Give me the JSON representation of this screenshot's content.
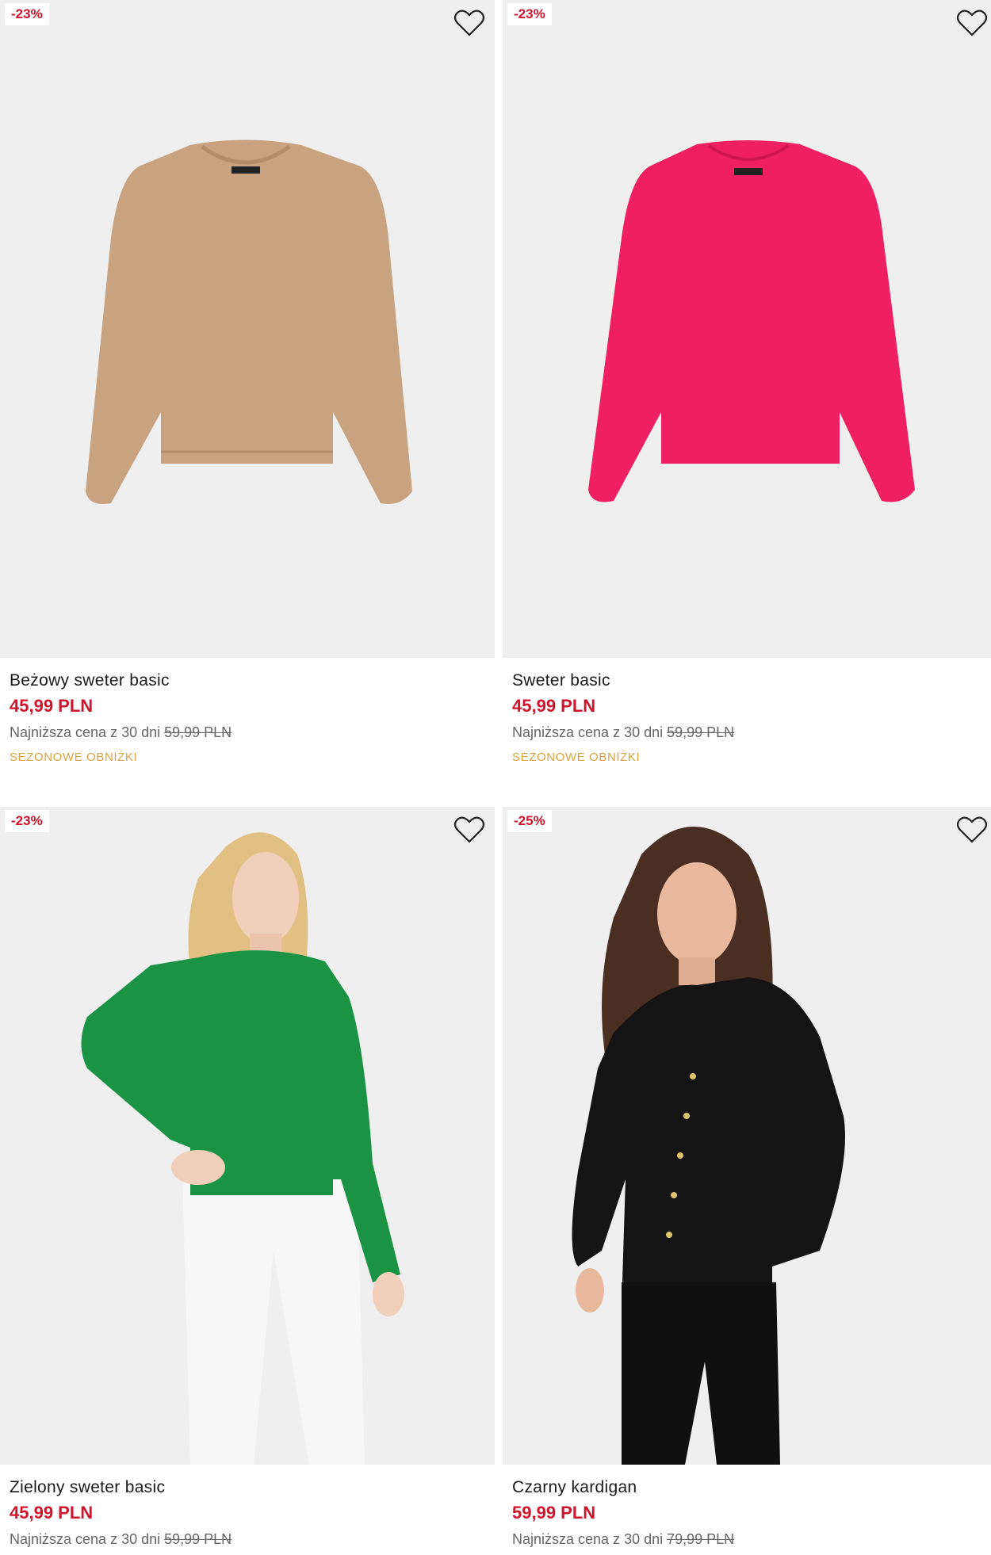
{
  "products": [
    {
      "name": "Beżowy sweter basic",
      "discount": "-23%",
      "price": "45,99 PLN",
      "lowest_label": "Najniższa cena z 30 dni",
      "lowest_price": "59,99 PLN",
      "promo": "SEZONOWE OBNIŻKI",
      "image": "beige-sweater-flatlay",
      "garment_color": "#c9a27f"
    },
    {
      "name": "Sweter basic",
      "discount": "-23%",
      "price": "45,99 PLN",
      "lowest_label": "Najniższa cena z 30 dni",
      "lowest_price": "59,99 PLN",
      "promo": "SEZONOWE OBNIŻKI",
      "image": "pink-sweater-flatlay",
      "garment_color": "#ee1f62"
    },
    {
      "name": "Zielony sweter basic",
      "discount": "-23%",
      "price": "45,99 PLN",
      "lowest_label": "Najniższa cena z 30 dni",
      "lowest_price": "59,99 PLN",
      "image": "green-sweater-model",
      "garment_color": "#1a9444"
    },
    {
      "name": "Czarny kardigan",
      "discount": "-25%",
      "price": "59,99 PLN",
      "lowest_label": "Najniższa cena z 30 dni",
      "lowest_price": "79,99 PLN",
      "image": "black-cardigan-model",
      "garment_color": "#141414"
    }
  ],
  "colors": {
    "sale_red": "#d0142c",
    "promo_gold": "#d9a441",
    "photo_bg": "#efefef"
  },
  "icons": {
    "wishlist": "heart-outline-icon"
  }
}
